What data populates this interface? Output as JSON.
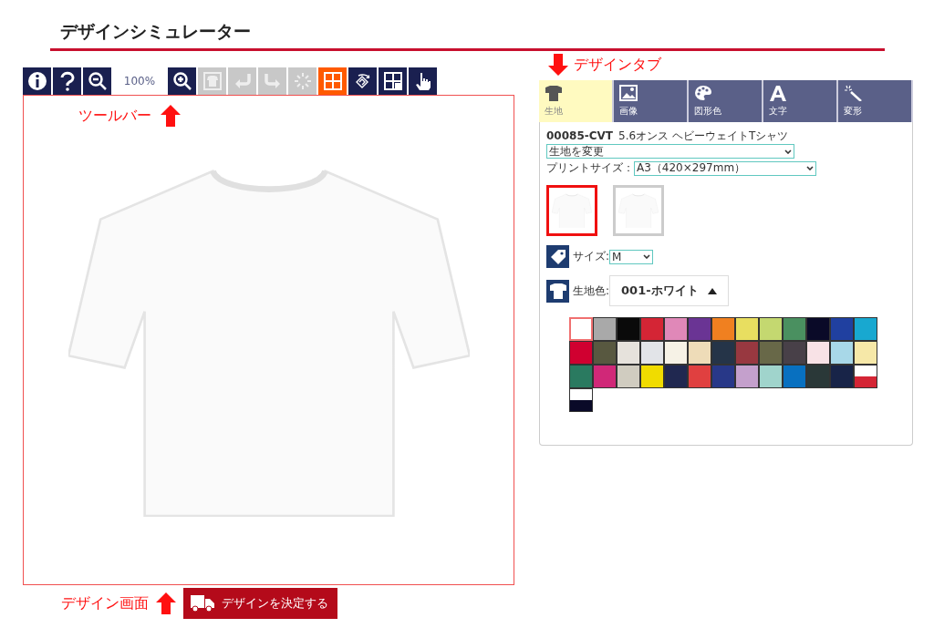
{
  "page_title": "デザインシミュレーター",
  "toolbar": {
    "tools_left": [
      {
        "kind": "info",
        "disabled": false,
        "selected": false
      },
      {
        "kind": "help",
        "disabled": false,
        "selected": false
      },
      {
        "kind": "zoom-out",
        "disabled": false,
        "selected": false
      }
    ],
    "zoom": "100%",
    "tools_right": [
      {
        "kind": "zoom-in",
        "disabled": false,
        "selected": false
      },
      {
        "kind": "shirt",
        "disabled": true,
        "selected": false
      },
      {
        "kind": "undo",
        "disabled": true,
        "selected": false
      },
      {
        "kind": "redo",
        "disabled": true,
        "selected": false
      },
      {
        "kind": "loading",
        "disabled": true,
        "selected": false
      },
      {
        "kind": "grid",
        "disabled": false,
        "selected": true
      },
      {
        "kind": "rotate",
        "disabled": false,
        "selected": false
      },
      {
        "kind": "layout",
        "disabled": false,
        "selected": false
      },
      {
        "kind": "hand",
        "disabled": false,
        "selected": false
      }
    ]
  },
  "annotations": {
    "toolbar": "ツールバー",
    "tabs": "デザインタブ",
    "canvas": "デザイン画面"
  },
  "tabs": [
    {
      "kind": "shirt",
      "label": "生地",
      "selected": true
    },
    {
      "kind": "image",
      "label": "画像",
      "selected": false
    },
    {
      "kind": "palette",
      "label": "図形色",
      "selected": false
    },
    {
      "kind": "text",
      "label": "文字",
      "selected": false
    },
    {
      "kind": "wand",
      "label": "変形",
      "selected": false
    }
  ],
  "product": {
    "code": "00085-CVT",
    "name": "5.6オンス ヘビーウェイトTシャツ"
  },
  "fabric_select": "生地を変更",
  "print_size": {
    "label": "プリントサイズ：",
    "value": "A3（420×297mm）"
  },
  "views": [
    {
      "selected": true
    },
    {
      "selected": false
    }
  ],
  "size": {
    "label": "サイズ:",
    "value": "M"
  },
  "fabric_color": {
    "label": "生地色:",
    "value": "001-ホワイト"
  },
  "swatches": [
    {
      "kind": "solid",
      "color": "#ffffff",
      "selected": true
    },
    {
      "kind": "solid",
      "color": "#a9a9a9",
      "selected": false
    },
    {
      "kind": "solid",
      "color": "#0a0a0a",
      "selected": false
    },
    {
      "kind": "solid",
      "color": "#d42535",
      "selected": false
    },
    {
      "kind": "solid",
      "color": "#e088b8",
      "selected": false
    },
    {
      "kind": "solid",
      "color": "#6a3494",
      "selected": false
    },
    {
      "kind": "solid",
      "color": "#f08020",
      "selected": false
    },
    {
      "kind": "solid",
      "color": "#e8de60",
      "selected": false
    },
    {
      "kind": "solid",
      "color": "#c4d870",
      "selected": false
    },
    {
      "kind": "solid",
      "color": "#4a9060",
      "selected": false
    },
    {
      "kind": "solid",
      "color": "#0a0a28",
      "selected": false
    },
    {
      "kind": "solid",
      "color": "#2040a0",
      "selected": false
    },
    {
      "kind": "solid",
      "color": "#18a8d0",
      "selected": false
    },
    {
      "kind": "solid",
      "color": "#d00030",
      "selected": false
    },
    {
      "kind": "solid",
      "color": "#585840",
      "selected": false
    },
    {
      "kind": "solid",
      "color": "#e6e2dc",
      "selected": false
    },
    {
      "kind": "solid",
      "color": "#e2e4e8",
      "selected": false
    },
    {
      "kind": "solid",
      "color": "#f6f2e6",
      "selected": false
    },
    {
      "kind": "solid",
      "color": "#eedcb8",
      "selected": false
    },
    {
      "kind": "solid",
      "color": "#253448",
      "selected": false
    },
    {
      "kind": "solid",
      "color": "#983840",
      "selected": false
    },
    {
      "kind": "solid",
      "color": "#686848",
      "selected": false
    },
    {
      "kind": "solid",
      "color": "#484048",
      "selected": false
    },
    {
      "kind": "solid",
      "color": "#f8e2e6",
      "selected": false
    },
    {
      "kind": "solid",
      "color": "#a8d8e8",
      "selected": false
    },
    {
      "kind": "solid",
      "color": "#f6e8a8",
      "selected": false
    },
    {
      "kind": "solid",
      "color": "#2a7a60",
      "selected": false
    },
    {
      "kind": "solid",
      "color": "#d02878",
      "selected": false
    },
    {
      "kind": "solid",
      "color": "#d0ccc0",
      "selected": false
    },
    {
      "kind": "solid",
      "color": "#f0dc00",
      "selected": false
    },
    {
      "kind": "solid",
      "color": "#202850",
      "selected": false
    },
    {
      "kind": "solid",
      "color": "#e04040",
      "selected": false
    },
    {
      "kind": "solid",
      "color": "#283888",
      "selected": false
    },
    {
      "kind": "solid",
      "color": "#c4a0cc",
      "selected": false
    },
    {
      "kind": "solid",
      "color": "#a0d4cc",
      "selected": false
    },
    {
      "kind": "solid",
      "color": "#0870c0",
      "selected": false
    },
    {
      "kind": "solid",
      "color": "#2a3838",
      "selected": false
    },
    {
      "kind": "solid",
      "color": "#182448",
      "selected": false
    },
    {
      "kind": "split",
      "halves": [
        {
          "color": "#ffffff"
        },
        {
          "color": "#d42535"
        }
      ],
      "selected": false
    },
    {
      "kind": "split",
      "halves": [
        {
          "color": "#ffffff"
        },
        {
          "color": "#0a0a28"
        }
      ],
      "selected": false
    }
  ],
  "decide_button": "デザインを決定する"
}
